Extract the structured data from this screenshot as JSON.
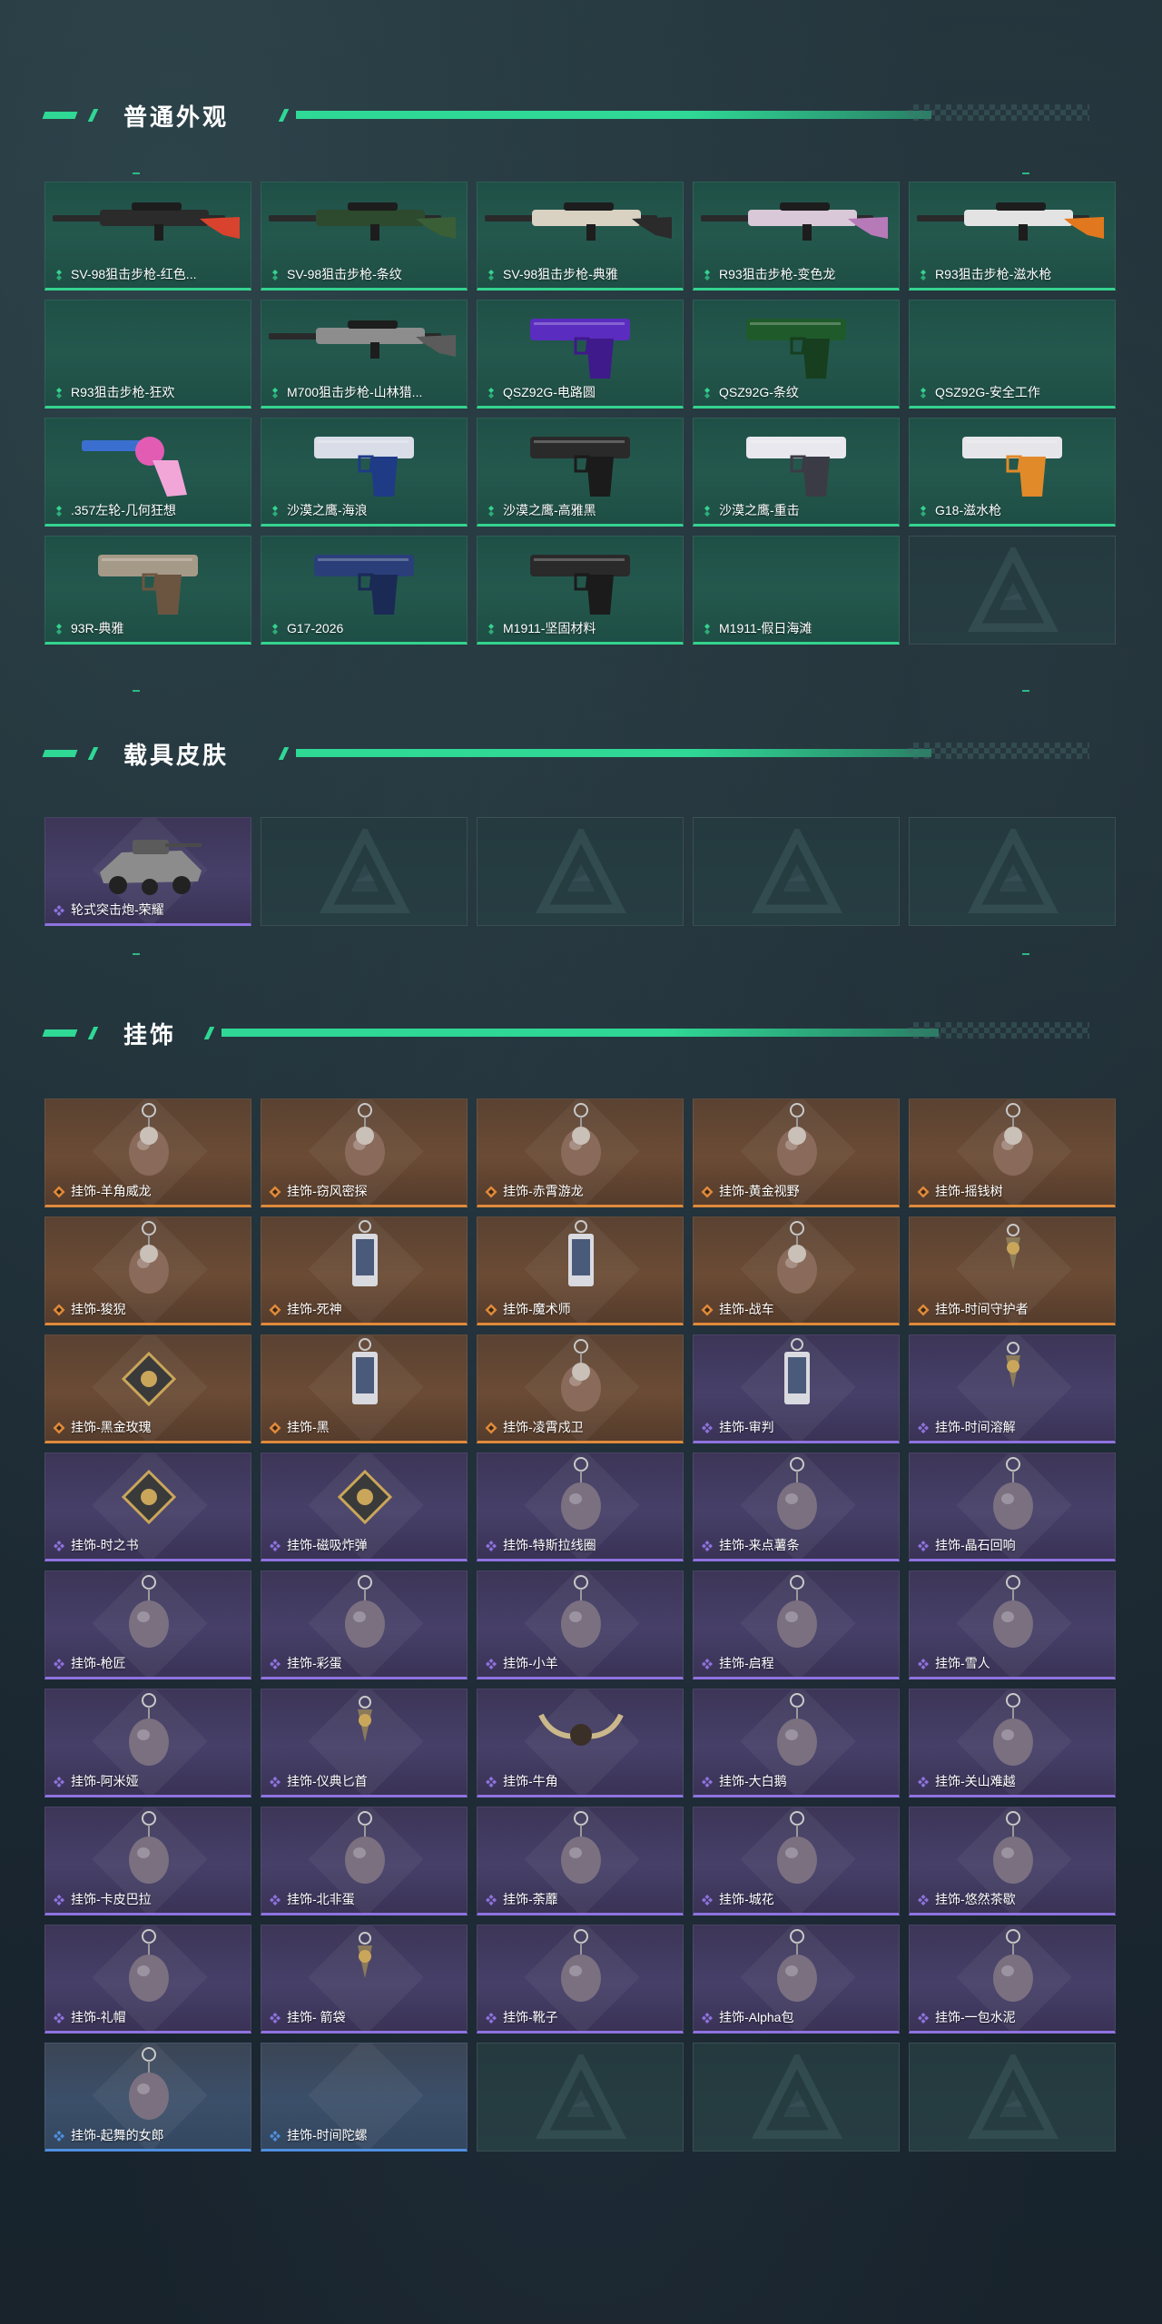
{
  "colors": {
    "accent_green": "#2fd895",
    "rarity_green": "#34d48f",
    "rarity_gold": "#e08a3a",
    "rarity_purple": "#8f72e0",
    "rarity_blue": "#4f8fe0"
  },
  "sections": [
    {
      "title": "普通外观",
      "cards": [
        {
          "name": "SV-98狙击步枪-红色...",
          "rarity": "green",
          "art": "sniper-red"
        },
        {
          "name": "SV-98狙击步枪-条纹",
          "rarity": "green",
          "art": "sniper-green"
        },
        {
          "name": "SV-98狙击步枪-典雅",
          "rarity": "green",
          "art": "sniper-white"
        },
        {
          "name": "R93狙击步枪-变色龙",
          "rarity": "green",
          "art": "sniper-pink"
        },
        {
          "name": "R93狙击步枪-滋水枪",
          "rarity": "green",
          "art": "sniper-orange"
        },
        {
          "name": "R93狙击步枪-狂欢",
          "rarity": "green",
          "art": "none"
        },
        {
          "name": "M700狙击步枪-山林猎...",
          "rarity": "green",
          "art": "rifle-grey"
        },
        {
          "name": "QSZ92G-电路圆",
          "rarity": "green",
          "art": "pistol-purple"
        },
        {
          "name": "QSZ92G-条纹",
          "rarity": "green",
          "art": "pistol-green"
        },
        {
          "name": "QSZ92G-安全工作",
          "rarity": "green",
          "art": "none"
        },
        {
          "name": ".357左轮-几何狂想",
          "rarity": "green",
          "art": "revolver-pink"
        },
        {
          "name": "沙漠之鹰-海浪",
          "rarity": "green",
          "art": "pistol-blue"
        },
        {
          "name": "沙漠之鹰-高雅黑",
          "rarity": "green",
          "art": "pistol-black"
        },
        {
          "name": "沙漠之鹰-重击",
          "rarity": "green",
          "art": "pistol-white"
        },
        {
          "name": "G18-滋水枪",
          "rarity": "green",
          "art": "pistol-orange"
        },
        {
          "name": "93R-典雅",
          "rarity": "green",
          "art": "pistol-tan"
        },
        {
          "name": "G17-2026",
          "rarity": "green",
          "art": "pistol-navy"
        },
        {
          "name": "M1911-坚固材料",
          "rarity": "green",
          "art": "pistol-black"
        },
        {
          "name": "M1911-假日海滩",
          "rarity": "green",
          "art": "none"
        },
        {
          "name": "",
          "rarity": "empty",
          "art": "none"
        }
      ]
    },
    {
      "title": "载具皮肤",
      "cards": [
        {
          "name": "轮式突击炮-荣耀",
          "rarity": "purple",
          "art": "vehicle"
        },
        {
          "name": "",
          "rarity": "empty",
          "art": "none"
        },
        {
          "name": "",
          "rarity": "empty",
          "art": "none"
        },
        {
          "name": "",
          "rarity": "empty",
          "art": "none"
        },
        {
          "name": "",
          "rarity": "empty",
          "art": "none"
        }
      ]
    },
    {
      "title": "挂饰",
      "cards": [
        {
          "name": "挂饰-羊角威龙",
          "rarity": "gold",
          "art": "charm-figure"
        },
        {
          "name": "挂饰-窃风密探",
          "rarity": "gold",
          "art": "charm-figure"
        },
        {
          "name": "挂饰-赤霄游龙",
          "rarity": "gold",
          "art": "charm-figure"
        },
        {
          "name": "挂饰-黄金视野",
          "rarity": "gold",
          "art": "charm-figure"
        },
        {
          "name": "挂饰-摇钱树",
          "rarity": "gold",
          "art": "charm-figure"
        },
        {
          "name": "挂饰-狻猊",
          "rarity": "gold",
          "art": "charm-figure"
        },
        {
          "name": "挂饰-死神",
          "rarity": "gold",
          "art": "charm-card"
        },
        {
          "name": "挂饰-魔术师",
          "rarity": "gold",
          "art": "charm-card"
        },
        {
          "name": "挂饰-战车",
          "rarity": "gold",
          "art": "charm-figure"
        },
        {
          "name": "挂饰-时间守护者",
          "rarity": "gold",
          "art": "charm-small"
        },
        {
          "name": "挂饰-黑金玫瑰",
          "rarity": "gold",
          "art": "charm-badge"
        },
        {
          "name": "挂饰-黑",
          "rarity": "gold",
          "art": "charm-card"
        },
        {
          "name": "挂饰-凌霄戍卫",
          "rarity": "gold",
          "art": "charm-figure"
        },
        {
          "name": "挂饰-审判",
          "rarity": "purple",
          "art": "charm-card"
        },
        {
          "name": "挂饰-时间溶解",
          "rarity": "purple",
          "art": "charm-small"
        },
        {
          "name": "挂饰-时之书",
          "rarity": "purple",
          "art": "charm-badge"
        },
        {
          "name": "挂饰-磁吸炸弹",
          "rarity": "purple",
          "art": "charm-badge"
        },
        {
          "name": "挂饰-特斯拉线圈",
          "rarity": "purple",
          "art": "charm-ring"
        },
        {
          "name": "挂饰-来点薯条",
          "rarity": "purple",
          "art": "charm-ring"
        },
        {
          "name": "挂饰-晶石回响",
          "rarity": "purple",
          "art": "charm-ring"
        },
        {
          "name": "挂饰-枪匠",
          "rarity": "purple",
          "art": "charm-ring"
        },
        {
          "name": "挂饰-彩蛋",
          "rarity": "purple",
          "art": "charm-ring"
        },
        {
          "name": "挂饰-小羊",
          "rarity": "purple",
          "art": "charm-ring"
        },
        {
          "name": "挂饰-启程",
          "rarity": "purple",
          "art": "charm-ring"
        },
        {
          "name": "挂饰-雪人",
          "rarity": "purple",
          "art": "charm-ring"
        },
        {
          "name": "挂饰-阿米娅",
          "rarity": "purple",
          "art": "charm-ring"
        },
        {
          "name": "挂饰-仪典匕首",
          "rarity": "purple",
          "art": "charm-small"
        },
        {
          "name": "挂饰-牛角",
          "rarity": "purple",
          "art": "charm-horns"
        },
        {
          "name": "挂饰-大白鹅",
          "rarity": "purple",
          "art": "charm-ring"
        },
        {
          "name": "挂饰-关山难越",
          "rarity": "purple",
          "art": "charm-ring"
        },
        {
          "name": "挂饰-卡皮巴拉",
          "rarity": "purple",
          "art": "charm-ring"
        },
        {
          "name": "挂饰-北非蛋",
          "rarity": "purple",
          "art": "charm-ring"
        },
        {
          "name": "挂饰-荼蘼",
          "rarity": "purple",
          "art": "charm-ring"
        },
        {
          "name": "挂饰-城花",
          "rarity": "purple",
          "art": "charm-ring"
        },
        {
          "name": "挂饰-悠然茶歇",
          "rarity": "purple",
          "art": "charm-ring"
        },
        {
          "name": "挂饰-礼帽",
          "rarity": "purple",
          "art": "charm-ring"
        },
        {
          "name": "挂饰- 箭袋",
          "rarity": "purple",
          "art": "charm-small"
        },
        {
          "name": "挂饰-靴子",
          "rarity": "purple",
          "art": "charm-ring"
        },
        {
          "name": "挂饰-Alpha包",
          "rarity": "purple",
          "art": "charm-ring"
        },
        {
          "name": "挂饰-一包水泥",
          "rarity": "purple",
          "art": "charm-ring"
        },
        {
          "name": "挂饰-起舞的女郎",
          "rarity": "blue",
          "art": "charm-ring"
        },
        {
          "name": "挂饰-时间陀螺",
          "rarity": "blue",
          "art": "none"
        },
        {
          "name": "",
          "rarity": "empty",
          "art": "none"
        },
        {
          "name": "",
          "rarity": "empty",
          "art": "none"
        },
        {
          "name": "",
          "rarity": "empty",
          "art": "none"
        }
      ]
    }
  ]
}
